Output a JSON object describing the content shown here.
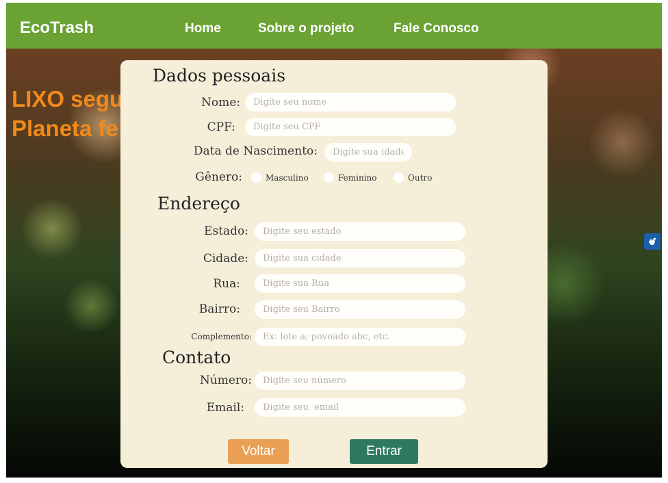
{
  "navbar": {
    "brand": "EcoTrash",
    "links": [
      "Home",
      "Sobre o projeto",
      "Fale Conosco"
    ]
  },
  "hero": {
    "line1": "LIXO segu",
    "line2": "Planeta fe"
  },
  "form": {
    "personal_title": "Dados pessoais",
    "nome": {
      "label": "Nome:",
      "placeholder": "Digite seu nome"
    },
    "cpf": {
      "label": "CPF:",
      "placeholder": "Digite seu CPF"
    },
    "nascimento": {
      "label": "Data de Nascimento:",
      "placeholder": "Digite sua idade"
    },
    "genero": {
      "label": "Gênero:",
      "options": [
        "Masculino",
        "Feminino",
        "Outro"
      ]
    },
    "address_title": "Endereço",
    "estado": {
      "label": "Estado:",
      "placeholder": "Digite seu estado"
    },
    "cidade": {
      "label": "Cidade:",
      "placeholder": "Digite sua cidade"
    },
    "rua": {
      "label": "Rua:",
      "placeholder": "Digite sua Rua"
    },
    "bairro": {
      "label": "Bairro:",
      "placeholder": "Digite seu Bairro"
    },
    "complemento": {
      "label": "Complemento:",
      "placeholder": "Ex: lote a; povoado abc, etc."
    },
    "contact_title": "Contato",
    "numero": {
      "label": "Número:",
      "placeholder": "Digite seu número"
    },
    "email": {
      "label": "Email:",
      "placeholder": "Digite seu  email"
    },
    "back_label": "Voltar",
    "submit_label": "Entrar"
  },
  "widget": {
    "icon": "sign-language-icon"
  },
  "colors": {
    "navbar": "#6aa334",
    "hero_text": "#f28a1a",
    "card": "#f5efd9",
    "back_button": "#e9a054",
    "submit_button": "#2f7a5e",
    "widget": "#1b5eaa"
  }
}
